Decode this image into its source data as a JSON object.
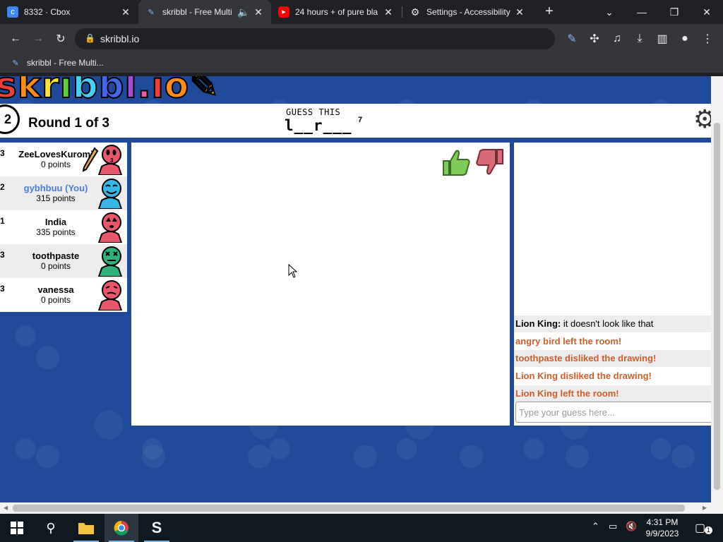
{
  "browser": {
    "tabs": [
      {
        "title": "8332 · Cbox",
        "favicon": "cbox-icon"
      },
      {
        "title": "skribbl - Free Multi",
        "favicon": "skribbl-icon",
        "active": true
      },
      {
        "title": "24 hours + of pure bla",
        "favicon": "youtube-icon"
      },
      {
        "title": "Settings - Accessibility",
        "favicon": "gear-icon"
      }
    ],
    "url": "skribbl.io",
    "bookmark": "skribbl - Free Multi..."
  },
  "game": {
    "logo": "skribbl.io",
    "round_number": "2",
    "round_label": "Round 1 of 3",
    "guess_label": "GUESS THIS",
    "guess_word": "l__r___",
    "guess_count": "7"
  },
  "players": [
    {
      "rank": "3",
      "name": "ZeeLovesKuromi",
      "points": "0 points",
      "avatar_color": "#e8566c",
      "drawing": true
    },
    {
      "rank": "2",
      "name": "gybhbuu (You)",
      "points": "315 points",
      "avatar_color": "#36b7e6",
      "you": true
    },
    {
      "rank": "1",
      "name": "India",
      "points": "335 points",
      "avatar_color": "#e8566c"
    },
    {
      "rank": "3",
      "name": "toothpaste",
      "points": "0 points",
      "avatar_color": "#2db37a"
    },
    {
      "rank": "3",
      "name": "vanessa",
      "points": "0 points",
      "avatar_color": "#e8566c"
    }
  ],
  "chat": {
    "messages": [
      {
        "author": "Lion King:",
        "text": "it doesn't look like that",
        "type": "guess"
      },
      {
        "text": "angry bird left the room!",
        "type": "system"
      },
      {
        "text": "toothpaste disliked the drawing!",
        "type": "system"
      },
      {
        "text": "Lion King disliked the drawing!",
        "type": "system"
      },
      {
        "text": "Lion King left the room!",
        "type": "system"
      }
    ],
    "input_placeholder": "Type your guess here..."
  },
  "taskbar": {
    "time": "4:31 PM",
    "date": "9/9/2023",
    "notifications": "1"
  },
  "colors": {
    "background_blue": "#1f4a9a",
    "system_message": "#cd5e2a",
    "you_name": "#4a7dd6"
  }
}
